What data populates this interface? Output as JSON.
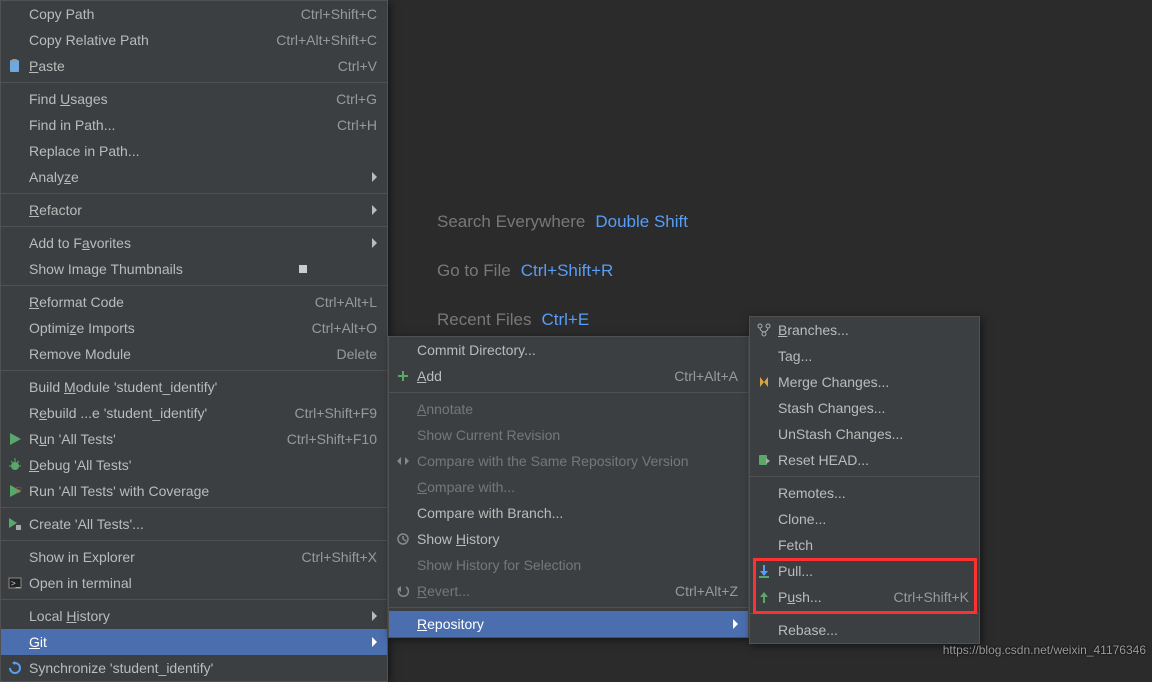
{
  "editor_hints": [
    {
      "label": "Search Everywhere",
      "shortcut": "Double Shift"
    },
    {
      "label": "Go to File",
      "shortcut": "Ctrl+Shift+R"
    },
    {
      "label": "Recent Files",
      "shortcut": "Ctrl+E"
    }
  ],
  "main_menu": {
    "items": [
      {
        "label": "Copy Path",
        "mn": "C",
        "after": "opy Path",
        "shortcut": "Ctrl+Shift+C"
      },
      {
        "label": "Copy Relative Path",
        "shortcut": "Ctrl+Alt+Shift+C"
      },
      {
        "icon": "paste-icon",
        "mn": "P",
        "after": "aste",
        "shortcut": "Ctrl+V"
      },
      {
        "sep": true
      },
      {
        "label_pre": "Find ",
        "mn": "U",
        "after": "sages",
        "shortcut": "Ctrl+G"
      },
      {
        "label": "Find in Path...",
        "shortcut": "Ctrl+H"
      },
      {
        "label": "Replace in Path..."
      },
      {
        "label_pre": "Analy",
        "mn": "z",
        "after": "e",
        "submenu": true
      },
      {
        "sep": true
      },
      {
        "mn": "R",
        "after": "efactor",
        "submenu": true
      },
      {
        "sep": true
      },
      {
        "label_pre": "Add to F",
        "mn": "a",
        "after": "vorites",
        "submenu": true
      },
      {
        "label": "Show Image Thumbnails",
        "thumb": true
      },
      {
        "sep": true
      },
      {
        "mn": "R",
        "after": "eformat Code",
        "shortcut": "Ctrl+Alt+L"
      },
      {
        "label_pre": "Optimi",
        "mn": "z",
        "after": "e Imports",
        "shortcut": "Ctrl+Alt+O"
      },
      {
        "label": "Remove Module",
        "shortcut": "Delete"
      },
      {
        "sep": true
      },
      {
        "label_pre": "Build ",
        "mn": "M",
        "after": "odule 'student_identify'"
      },
      {
        "label_pre": "R",
        "mn": "e",
        "after": "build ...e 'student_identify'",
        "shortcut": "Ctrl+Shift+F9"
      },
      {
        "icon": "run-icon",
        "label_pre": "R",
        "mn": "u",
        "after": "n 'All Tests'",
        "shortcut": "Ctrl+Shift+F10"
      },
      {
        "icon": "debug-icon",
        "mn": "D",
        "after": "ebug 'All Tests'"
      },
      {
        "icon": "coverage-icon",
        "label": "Run 'All Tests' with Coverage"
      },
      {
        "sep": true
      },
      {
        "icon": "edit-config-icon",
        "label": "Create 'All Tests'..."
      },
      {
        "sep": true
      },
      {
        "label": "Show in Explorer",
        "shortcut": "Ctrl+Shift+X"
      },
      {
        "icon": "terminal-icon",
        "label": "Open in terminal"
      },
      {
        "sep": true
      },
      {
        "label_pre": "Local ",
        "mn": "H",
        "after": "istory",
        "submenu": true
      },
      {
        "mn": "G",
        "after": "it",
        "submenu": true,
        "highlighted": true
      },
      {
        "icon": "sync-icon",
        "label": "Synchronize 'student_identify'"
      }
    ]
  },
  "submenu_vcs": {
    "items": [
      {
        "label": "Commit Directory..."
      },
      {
        "icon": "add-icon",
        "mn": "A",
        "after": "dd",
        "shortcut": "Ctrl+Alt+A"
      },
      {
        "sep": true
      },
      {
        "mn": "A",
        "after": "nnotate",
        "disabled": true
      },
      {
        "label": "Show Current Revision",
        "disabled": true
      },
      {
        "icon": "compare-icon",
        "label": "Compare with the Same Repository Version",
        "disabled": true
      },
      {
        "mn": "C",
        "after": "ompare with...",
        "disabled": true
      },
      {
        "label": "Compare with Branch..."
      },
      {
        "icon": "history-icon",
        "label_pre": "Show ",
        "mn": "H",
        "after": "istory"
      },
      {
        "label": "Show History for Selection",
        "disabled": true
      },
      {
        "icon": "revert-icon",
        "mn": "R",
        "after": "evert...",
        "shortcut": "Ctrl+Alt+Z",
        "disabled": true
      },
      {
        "sep": true
      },
      {
        "mn": "R",
        "after": "epository",
        "submenu": true,
        "highlighted": true
      }
    ]
  },
  "submenu_git": {
    "items": [
      {
        "icon": "branches-icon",
        "mn": "B",
        "after": "ranches..."
      },
      {
        "label": "Tag..."
      },
      {
        "icon": "merge-icon",
        "label": "Merge Changes..."
      },
      {
        "label": "Stash Changes..."
      },
      {
        "label": "UnStash Changes..."
      },
      {
        "icon": "reset-icon",
        "label": "Reset HEAD..."
      },
      {
        "sep": true
      },
      {
        "label": "Remotes..."
      },
      {
        "label": "Clone..."
      },
      {
        "label": "Fetch"
      },
      {
        "icon": "pull-icon",
        "label": "Pull..."
      },
      {
        "icon": "push-icon",
        "label_pre": "P",
        "mn": "u",
        "after": "sh...",
        "shortcut": "Ctrl+Shift+K"
      },
      {
        "sep": true
      },
      {
        "label": "Rebase..."
      }
    ]
  },
  "watermark": "https://blog.csdn.net/weixin_41176346"
}
